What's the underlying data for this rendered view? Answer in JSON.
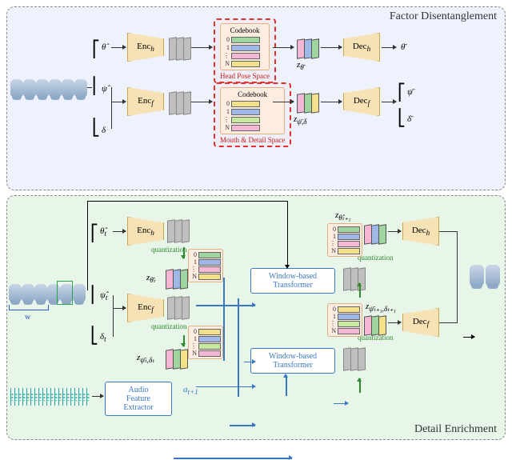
{
  "top": {
    "title": "Factor Disentanglement",
    "input_labels": {
      "theta_hat": "θ̂",
      "psi_hat": "ψ̂",
      "delta": "δ"
    },
    "encoders": {
      "h": "Enc",
      "h_sub": "h",
      "f": "Enc",
      "f_sub": "f"
    },
    "decoders": {
      "h": "Dec",
      "h_sub": "h",
      "f": "Dec",
      "f_sub": "f"
    },
    "codebook_header": "Codebook",
    "codebook_indices": [
      "0",
      "1",
      "⋮",
      "N"
    ],
    "space_labels": {
      "head": "Head Pose Space",
      "mouth": "Mouth & Detail Space"
    },
    "z_labels": {
      "z_theta": "z",
      "z_theta_sub": "θ̄",
      "z_psi": "z",
      "z_psi_sub": "ψ̄,δ"
    },
    "output_labels": {
      "theta_bar": "θ̄",
      "psi_bar": "ψ̄",
      "delta_bar": "δ̄"
    },
    "cb_colors_top": [
      "#9fd59f",
      "#9fb8e8",
      "#f4b8d4",
      "#f2e08a"
    ],
    "cb_colors_bot": [
      "#f2e08a",
      "#9fb8e8",
      "#c6e89f",
      "#f4b8d4"
    ],
    "z_colors_top": [
      "#f4b8d4",
      "#9fb8e8",
      "#9fd59f"
    ],
    "z_colors_bot": [
      "#f4b8d4",
      "#9fd59f",
      "#f2e08a"
    ]
  },
  "bot": {
    "title": "Detail Enrichment",
    "w_label": "w",
    "input_labels": {
      "theta_hat_t": "θ̂",
      "theta_hat_t_sub": "t",
      "psi_hat_t": "ψ̂",
      "psi_hat_t_sub": "t",
      "delta_t": "δ",
      "delta_t_sub": "t"
    },
    "encoders": {
      "h": "Enc",
      "h_sub": "h",
      "f": "Enc",
      "f_sub": "f"
    },
    "decoders": {
      "h": "Dec",
      "h_sub": "h",
      "f": "Dec",
      "f_sub": "f"
    },
    "quantization": "quantization",
    "codebook_indices": [
      "0",
      "1",
      "⋮",
      "N"
    ],
    "z_labels": {
      "z_theta_t": "z",
      "z_theta_t_sub": "θ̄ₜ",
      "z_psi_t": "z",
      "z_psi_t_sub": "ψ̄ₜ,δₜ",
      "z_theta_t1": "z",
      "z_theta_t1_sub": "θ̂ₜ₊₁",
      "z_psi_t1": "z",
      "z_psi_t1_sub": "ψ̄ₜ₊₁,δₜ₊₁"
    },
    "transformer": "Window-based\nTransformer",
    "audio_extractor": "Audio\nFeature\nExtractor",
    "a_label": "a",
    "a_sub": "t+1",
    "cb_colors_a": [
      "#9fd59f",
      "#9fb8e8",
      "#f4b8d4",
      "#f2e08a"
    ],
    "cb_colors_b": [
      "#f2e08a",
      "#9fb8e8",
      "#c6e89f",
      "#f4b8d4"
    ],
    "z_colors_theta": [
      "#f4b8d4",
      "#9fb8e8",
      "#9fd59f"
    ],
    "z_colors_psi": [
      "#f4b8d4",
      "#9fd59f",
      "#f2e08a"
    ]
  }
}
